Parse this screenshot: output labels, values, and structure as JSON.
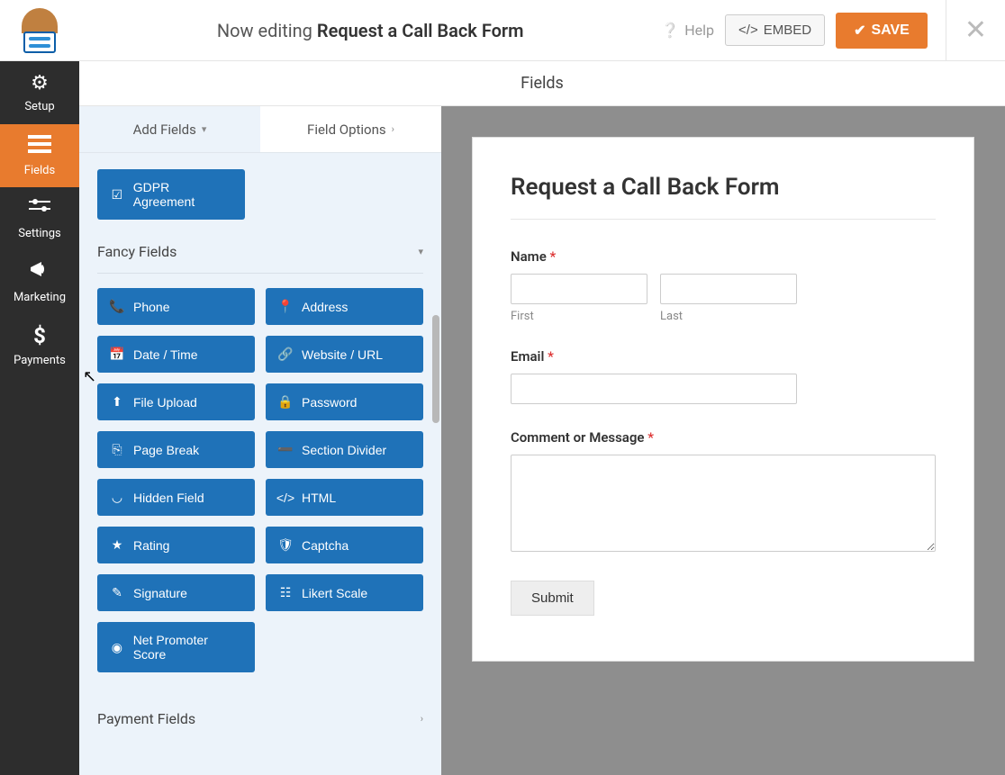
{
  "header": {
    "editing_prefix": "Now editing ",
    "form_name": "Request a Call Back Form",
    "help": "Help",
    "embed": "EMBED",
    "save": "SAVE"
  },
  "sidenav": [
    {
      "id": "setup",
      "label": "Setup",
      "icon": "⚙"
    },
    {
      "id": "fields",
      "label": "Fields",
      "icon": "▤",
      "active": true
    },
    {
      "id": "settings",
      "label": "Settings",
      "icon": "⚙"
    },
    {
      "id": "marketing",
      "label": "Marketing",
      "icon": "📣"
    },
    {
      "id": "payments",
      "label": "Payments",
      "icon": "$"
    }
  ],
  "panel_title": "Fields",
  "tabs": {
    "add": "Add Fields",
    "options": "Field Options"
  },
  "gdpr_field": "GDPR Agreement",
  "groups": {
    "fancy": "Fancy Fields",
    "payment": "Payment Fields"
  },
  "fancy_fields": [
    {
      "icon": "📞",
      "label": "Phone"
    },
    {
      "icon": "📍",
      "label": "Address"
    },
    {
      "icon": "📅",
      "label": "Date / Time"
    },
    {
      "icon": "🔗",
      "label": "Website / URL"
    },
    {
      "icon": "⬆",
      "label": "File Upload"
    },
    {
      "icon": "🔒",
      "label": "Password"
    },
    {
      "icon": "⎘",
      "label": "Page Break"
    },
    {
      "icon": "➖",
      "label": "Section Divider"
    },
    {
      "icon": "◡",
      "label": "Hidden Field"
    },
    {
      "icon": "</>",
      "label": "HTML"
    },
    {
      "icon": "★",
      "label": "Rating"
    },
    {
      "icon": "🛡",
      "label": "Captcha"
    },
    {
      "icon": "✎",
      "label": "Signature"
    },
    {
      "icon": "☷",
      "label": "Likert Scale"
    },
    {
      "icon": "◉",
      "label": "Net Promoter Score"
    }
  ],
  "preview": {
    "title": "Request a Call Back Form",
    "name_label": "Name",
    "first": "First",
    "last": "Last",
    "email_label": "Email",
    "comment_label": "Comment or Message",
    "submit": "Submit"
  }
}
